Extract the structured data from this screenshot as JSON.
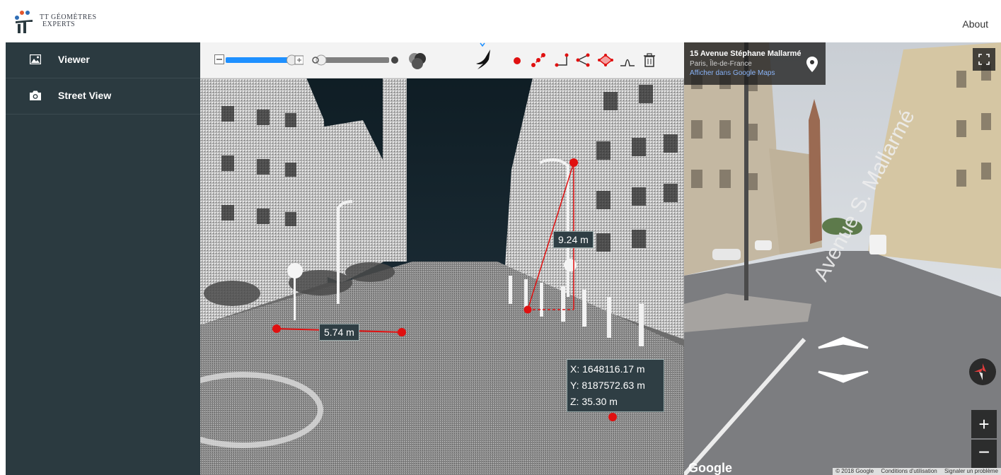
{
  "header": {
    "logo_line1": "TT GÉOMÈTRES",
    "logo_line2": "EXPERTS",
    "about_label": "About"
  },
  "sidebar": {
    "items": [
      {
        "label": "Viewer",
        "icon": "image-icon"
      },
      {
        "label": "Street View",
        "icon": "camera-icon"
      }
    ]
  },
  "viewer": {
    "toolbar": {
      "point_budget_fraction": 0.85,
      "icons": [
        "zoom-slider",
        "opacity-slider",
        "material-icon",
        "bird-icon",
        "point-measure-icon",
        "distance-measure-icon",
        "height-measure-icon",
        "angle-measure-icon",
        "area-measure-icon",
        "profile-icon",
        "trash-icon"
      ]
    },
    "measurements": {
      "distance_label": "5.74 m",
      "height_label": "9.24 m",
      "coordinates": {
        "x": "X: 1648116.17 m",
        "y": "Y: 8187572.63 m",
        "z": "Z: 35.30 m"
      }
    },
    "colors": {
      "measure": "#e01010",
      "label_bg": "#2f3e44"
    }
  },
  "streetview": {
    "title": "15 Avenue Stéphane Mallarmé",
    "subtitle": "Paris, Île-de-France",
    "link": "Afficher dans Google Maps",
    "street_label": "Avenue S. Mallarmé",
    "google": "Google",
    "footer": [
      "© 2018 Google",
      "Conditions d'utilisation",
      "Signaler un problème"
    ]
  }
}
